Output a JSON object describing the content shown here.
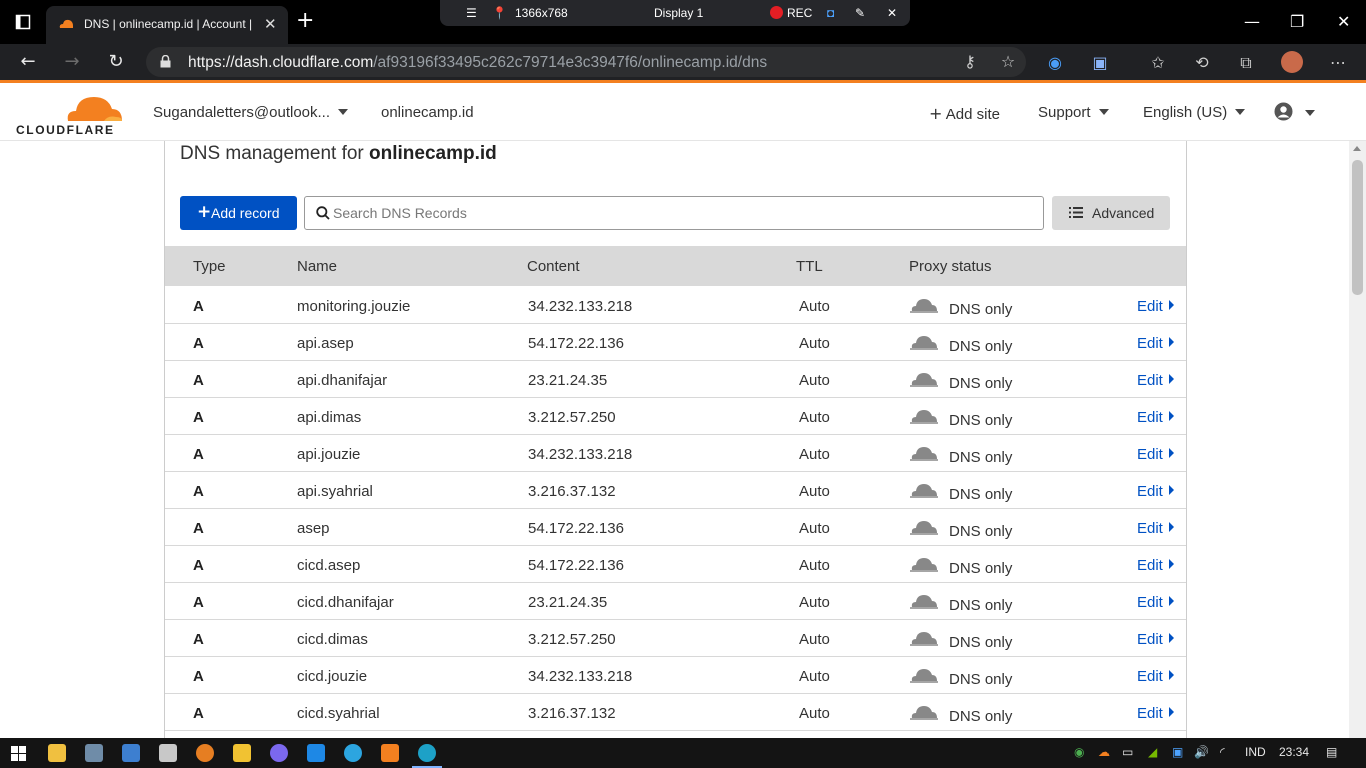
{
  "browser": {
    "tab_title": "DNS | onlinecamp.id | Account | C",
    "new_tab_icon": "plus-icon",
    "url_host": "https://dash.cloudflare.com",
    "url_path": "/af93196f33495c262c79714e3c3947f6/onlinecamp.id/dns"
  },
  "recorder": {
    "resolution": "1366x768",
    "display": "Display 1",
    "rec_label": "REC"
  },
  "header": {
    "logo_text": "CLOUDFLARE",
    "account": "Sugandaletters@outlook...",
    "zone": "onlinecamp.id",
    "add_site": "Add site",
    "support": "Support",
    "language": "English (US)"
  },
  "page": {
    "title_prefix": "DNS management for ",
    "title_domain": "onlinecamp.id",
    "add_record": "Add record",
    "search_placeholder": "Search DNS Records",
    "advanced": "Advanced"
  },
  "table": {
    "headers": {
      "type": "Type",
      "name": "Name",
      "content": "Content",
      "ttl": "TTL",
      "proxy": "Proxy status"
    },
    "edit_label": "Edit",
    "rows": [
      {
        "type": "A",
        "name": "monitoring.jouzie",
        "content": "34.232.133.218",
        "ttl": "Auto",
        "proxy": "DNS only"
      },
      {
        "type": "A",
        "name": "api.asep",
        "content": "54.172.22.136",
        "ttl": "Auto",
        "proxy": "DNS only"
      },
      {
        "type": "A",
        "name": "api.dhanifajar",
        "content": "23.21.24.35",
        "ttl": "Auto",
        "proxy": "DNS only"
      },
      {
        "type": "A",
        "name": "api.dimas",
        "content": "3.212.57.250",
        "ttl": "Auto",
        "proxy": "DNS only"
      },
      {
        "type": "A",
        "name": "api.jouzie",
        "content": "34.232.133.218",
        "ttl": "Auto",
        "proxy": "DNS only"
      },
      {
        "type": "A",
        "name": "api.syahrial",
        "content": "3.216.37.132",
        "ttl": "Auto",
        "proxy": "DNS only"
      },
      {
        "type": "A",
        "name": "asep",
        "content": "54.172.22.136",
        "ttl": "Auto",
        "proxy": "DNS only"
      },
      {
        "type": "A",
        "name": "cicd.asep",
        "content": "54.172.22.136",
        "ttl": "Auto",
        "proxy": "DNS only"
      },
      {
        "type": "A",
        "name": "cicd.dhanifajar",
        "content": "23.21.24.35",
        "ttl": "Auto",
        "proxy": "DNS only"
      },
      {
        "type": "A",
        "name": "cicd.dimas",
        "content": "3.212.57.250",
        "ttl": "Auto",
        "proxy": "DNS only"
      },
      {
        "type": "A",
        "name": "cicd.jouzie",
        "content": "34.232.133.218",
        "ttl": "Auto",
        "proxy": "DNS only"
      },
      {
        "type": "A",
        "name": "cicd.syahrial",
        "content": "3.216.37.132",
        "ttl": "Auto",
        "proxy": "DNS only"
      }
    ]
  },
  "taskbar": {
    "language": "IND",
    "time": "23:34"
  },
  "colors": {
    "brand_orange": "#f38020",
    "primary_blue": "#0051c3"
  }
}
